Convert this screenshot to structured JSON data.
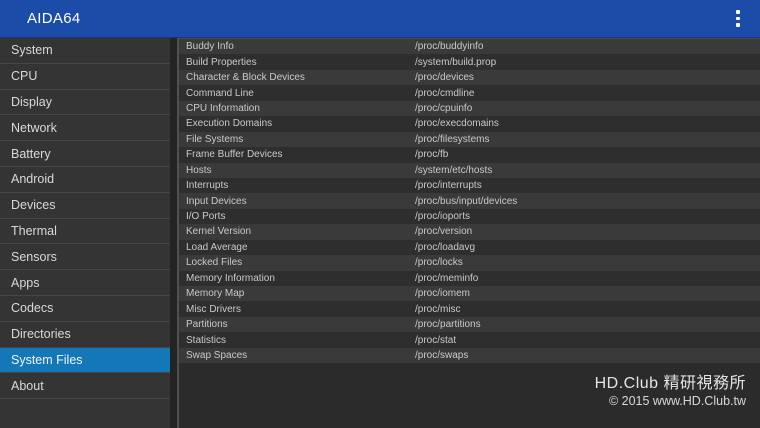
{
  "appbar": {
    "title": "AIDA64",
    "bg_color": "#1b4da8",
    "overflow_icon": "more-vertical-dots"
  },
  "sidebar": {
    "selected_item": "System Files",
    "selected_bg_color": "#1478b8",
    "items": [
      {
        "label": "System"
      },
      {
        "label": "CPU"
      },
      {
        "label": "Display"
      },
      {
        "label": "Network"
      },
      {
        "label": "Battery"
      },
      {
        "label": "Android"
      },
      {
        "label": "Devices"
      },
      {
        "label": "Thermal"
      },
      {
        "label": "Sensors"
      },
      {
        "label": "Apps"
      },
      {
        "label": "Codecs"
      },
      {
        "label": "Directories"
      },
      {
        "label": "System Files",
        "selected": true
      },
      {
        "label": "About"
      }
    ]
  },
  "files": {
    "rows": [
      {
        "name": "Buddy Info",
        "path": "/proc/buddyinfo"
      },
      {
        "name": "Build Properties",
        "path": "/system/build.prop"
      },
      {
        "name": "Character & Block Devices",
        "path": "/proc/devices"
      },
      {
        "name": "Command Line",
        "path": "/proc/cmdline"
      },
      {
        "name": "CPU Information",
        "path": "/proc/cpuinfo"
      },
      {
        "name": "Execution Domains",
        "path": "/proc/execdomains"
      },
      {
        "name": "File Systems",
        "path": "/proc/filesystems"
      },
      {
        "name": "Frame Buffer Devices",
        "path": "/proc/fb"
      },
      {
        "name": "Hosts",
        "path": "/system/etc/hosts"
      },
      {
        "name": "Interrupts",
        "path": "/proc/interrupts"
      },
      {
        "name": "Input Devices",
        "path": "/proc/bus/input/devices"
      },
      {
        "name": "I/O Ports",
        "path": "/proc/ioports"
      },
      {
        "name": "Kernel Version",
        "path": "/proc/version"
      },
      {
        "name": "Load Average",
        "path": "/proc/loadavg"
      },
      {
        "name": "Locked Files",
        "path": "/proc/locks"
      },
      {
        "name": "Memory Information",
        "path": "/proc/meminfo"
      },
      {
        "name": "Memory Map",
        "path": "/proc/iomem"
      },
      {
        "name": "Misc Drivers",
        "path": "/proc/misc"
      },
      {
        "name": "Partitions",
        "path": "/proc/partitions"
      },
      {
        "name": "Statistics",
        "path": "/proc/stat"
      },
      {
        "name": "Swap Spaces",
        "path": "/proc/swaps"
      }
    ]
  },
  "watermark": {
    "line1": "HD.Club 精研視務所",
    "line2": "© 2015  www.HD.Club.tw"
  }
}
